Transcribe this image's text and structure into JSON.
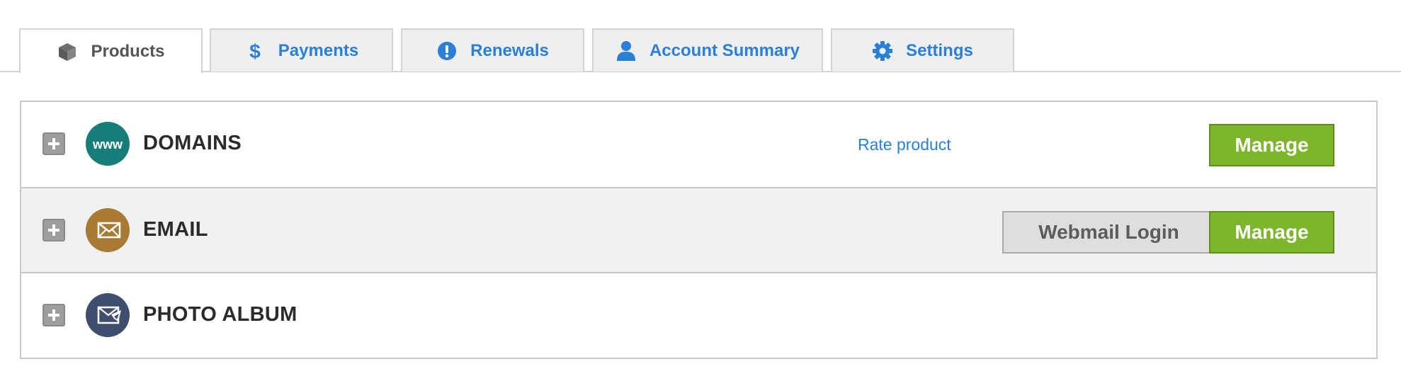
{
  "tabs": [
    {
      "label": "Products",
      "icon": "cube-icon",
      "active": true
    },
    {
      "label": "Payments",
      "icon": "dollar-icon",
      "active": false
    },
    {
      "label": "Renewals",
      "icon": "alert-icon",
      "active": false
    },
    {
      "label": "Account Summary",
      "icon": "user-icon",
      "active": false
    },
    {
      "label": "Settings",
      "icon": "gear-icon",
      "active": false
    }
  ],
  "products": [
    {
      "name": "DOMAINS",
      "icon": "www-icon",
      "icon_color": "#177d78",
      "rate_link": "Rate product",
      "manage_label": "Manage"
    },
    {
      "name": "EMAIL",
      "icon": "envelope-icon",
      "icon_color": "#a97a33",
      "webmail_label": "Webmail Login",
      "manage_label": "Manage"
    },
    {
      "name": "PHOTO ALBUM",
      "icon": "photo-album-icon",
      "icon_color": "#3f4d6f"
    }
  ],
  "icon_text": {
    "www": "www"
  },
  "colors": {
    "link_blue": "#2a7fd8",
    "manage_green": "#7db52c",
    "row_alt_bg": "#f1f1f1",
    "tab_bg": "#efefef"
  }
}
